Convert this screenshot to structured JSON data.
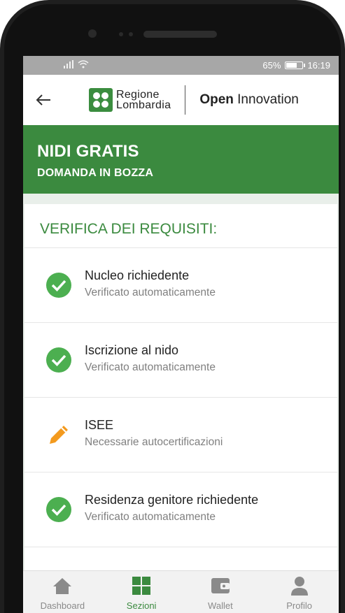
{
  "statusbar": {
    "battery": "65%",
    "time": "16:19"
  },
  "header": {
    "logo_line1": "Regione",
    "logo_line2": "Lombardia",
    "brand_bold": "Open",
    "brand_rest": "Innovation"
  },
  "hero": {
    "title": "NIDI GRATIS",
    "subtitle": "DOMANDA IN BOZZA"
  },
  "section": {
    "title": "VERIFICA DEI REQUISITI:"
  },
  "requirements": [
    {
      "title": "Nucleo richiedente",
      "status": "Verificato automaticamente",
      "icon": "check-circle-icon"
    },
    {
      "title": "Iscrizione al nido",
      "status": "Verificato automaticamente",
      "icon": "check-circle-icon"
    },
    {
      "title": "ISEE",
      "status": "Necessarie autocertificazioni",
      "icon": "pencil-icon"
    },
    {
      "title": "Residenza genitore richiedente",
      "status": "Verificato automaticamente",
      "icon": "check-circle-icon"
    }
  ],
  "nav": [
    {
      "label": "Dashboard",
      "icon": "home-icon"
    },
    {
      "label": "Sezioni",
      "icon": "grid-icon"
    },
    {
      "label": "Wallet",
      "icon": "wallet-icon"
    },
    {
      "label": "Profilo",
      "icon": "person-icon"
    }
  ],
  "colors": {
    "primary": "#3b8a3f",
    "success": "#4caf50",
    "warning": "#f39a1e"
  }
}
